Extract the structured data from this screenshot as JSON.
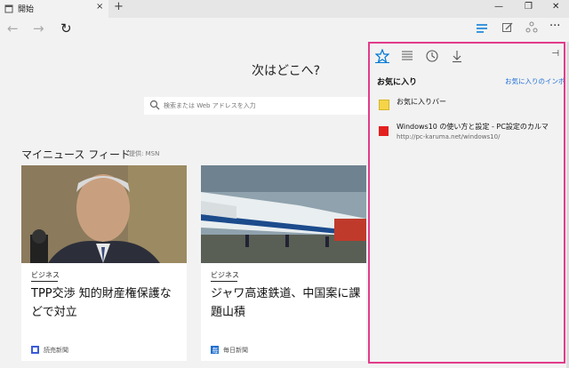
{
  "tab": {
    "title": "開始",
    "close": "×"
  },
  "newtab": "+",
  "window": {
    "minimize": "—",
    "restore": "❐",
    "close": "✕"
  },
  "nav": {
    "back": "←",
    "forward": "→",
    "refresh": "↻",
    "more": "···"
  },
  "main": {
    "heading": "次はどこへ?",
    "search_placeholder": "検索または Web アドレスを入力",
    "feed_title": "マイニュース フィード",
    "feed_provider": "提供: MSN"
  },
  "cards": [
    {
      "category": "ビジネス",
      "headline": "TPP交渉 知的財産権保護などで対立",
      "source": "読売新聞",
      "source_color": "#3b5bdb"
    },
    {
      "category": "ビジネス",
      "headline": "ジャワ高速鉄道、中国案に課題山積",
      "source": "毎日新聞",
      "source_color": "#1f6fd0"
    }
  ],
  "panel": {
    "tabs": [
      "favorites-icon",
      "reading-list-icon",
      "history-icon",
      "downloads-icon"
    ],
    "pin": "⊣",
    "heading": "お気に入り",
    "import_link": "お気に入りのインポート",
    "items": [
      {
        "name": "お気に入りバー",
        "url": ""
      },
      {
        "name": "Windows10 の使い方と設定 - PC設定のカルマ",
        "url": "http://pc-karuma.net/windows10/"
      }
    ]
  },
  "colors": {
    "accent": "#0078d7",
    "highlight_border": "#e23b8a",
    "panel_bg": "#f2f2f2"
  }
}
